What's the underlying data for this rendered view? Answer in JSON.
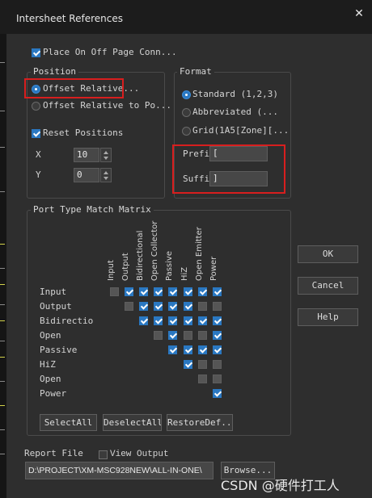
{
  "window": {
    "title": "Intersheet References"
  },
  "place_off_page": {
    "label": "Place On Off Page Conn...",
    "checked": true
  },
  "position": {
    "group_label": "Position",
    "options": [
      {
        "label": "Offset Relative...",
        "selected": true
      },
      {
        "label": "Offset Relative to Po...",
        "selected": false
      }
    ],
    "reset_label": "Reset Positions",
    "reset_checked": true,
    "x_label": "X",
    "x_value": "10",
    "y_label": "Y",
    "y_value": "0"
  },
  "format": {
    "group_label": "Format",
    "options": [
      {
        "label": "Standard (1,2,3)",
        "selected": true
      },
      {
        "label": "Abbreviated (...",
        "selected": false
      },
      {
        "label": "Grid(1A5[Zone][...",
        "selected": false
      }
    ],
    "prefix_label": "Prefi",
    "prefix_value": "[",
    "suffix_label": "Suffi",
    "suffix_value": "]"
  },
  "matrix": {
    "group_label": "Port Type Match Matrix",
    "columns": [
      "Input",
      "Output",
      "Bidirectional",
      "Open Collector",
      "Passive",
      "HiZ",
      "Open Emitter",
      "Power"
    ],
    "rows": [
      {
        "label": "Input",
        "cells": [
          false,
          true,
          true,
          true,
          true,
          true,
          true,
          true
        ]
      },
      {
        "label": "Output",
        "cells": [
          null,
          false,
          true,
          true,
          true,
          true,
          false,
          false
        ]
      },
      {
        "label": "Bidirectior",
        "cells": [
          null,
          null,
          true,
          true,
          true,
          true,
          true,
          true
        ]
      },
      {
        "label": "Open",
        "cells": [
          null,
          null,
          null,
          false,
          true,
          false,
          false,
          true
        ]
      },
      {
        "label": "Passive",
        "cells": [
          null,
          null,
          null,
          null,
          true,
          true,
          true,
          true
        ]
      },
      {
        "label": "HiZ",
        "cells": [
          null,
          null,
          null,
          null,
          null,
          true,
          false,
          false
        ]
      },
      {
        "label": "Open",
        "cells": [
          null,
          null,
          null,
          null,
          null,
          null,
          false,
          false
        ]
      },
      {
        "label": "Power",
        "cells": [
          null,
          null,
          null,
          null,
          null,
          null,
          null,
          true
        ]
      }
    ],
    "buttons": {
      "select_all": "SelectAll",
      "deselect_all": "DeselectAll",
      "restore_defaults": "RestoreDef..."
    }
  },
  "actions": {
    "ok": "OK",
    "cancel": "Cancel",
    "help": "Help"
  },
  "report": {
    "label": "Report File",
    "view_output_label": "View Output",
    "view_output_checked": false,
    "path": "D:\\PROJECT\\XM-MSC928NEW\\ALL-IN-ONE\\",
    "browse_label": "Browse..."
  },
  "watermark": "CSDN @硬件打工人",
  "colors": {
    "accent": "#2a78c2",
    "highlight_box": "#d81e1e",
    "background": "#2e2e2e"
  }
}
